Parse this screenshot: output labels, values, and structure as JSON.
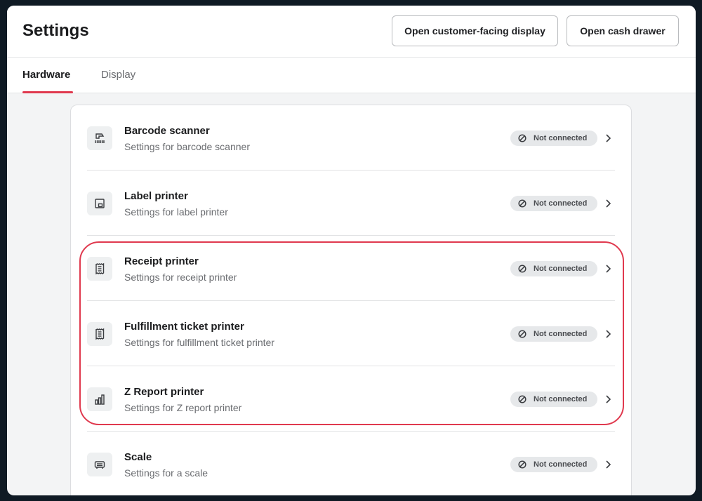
{
  "header": {
    "title": "Settings",
    "btn_display": "Open customer-facing display",
    "btn_drawer": "Open cash drawer"
  },
  "tabs": [
    {
      "label": "Hardware",
      "active": true
    },
    {
      "label": "Display",
      "active": false
    }
  ],
  "devices": [
    {
      "title": "Barcode scanner",
      "subtitle": "Settings for barcode scanner",
      "status": "Not connected",
      "icon": "barcode-scanner-icon"
    },
    {
      "title": "Label printer",
      "subtitle": "Settings for label printer",
      "status": "Not connected",
      "icon": "label-printer-icon"
    },
    {
      "title": "Receipt printer",
      "subtitle": "Settings for receipt printer",
      "status": "Not connected",
      "icon": "receipt-icon"
    },
    {
      "title": "Fulfillment ticket printer",
      "subtitle": "Settings for fulfillment ticket printer",
      "status": "Not connected",
      "icon": "ticket-icon"
    },
    {
      "title": "Z Report printer",
      "subtitle": "Settings for Z report printer",
      "status": "Not connected",
      "icon": "bar-chart-icon"
    },
    {
      "title": "Scale",
      "subtitle": "Settings for a scale",
      "status": "Not connected",
      "icon": "scale-icon"
    }
  ],
  "colors": {
    "accent": "#e0394e",
    "badge_bg": "#e6e8ea"
  }
}
